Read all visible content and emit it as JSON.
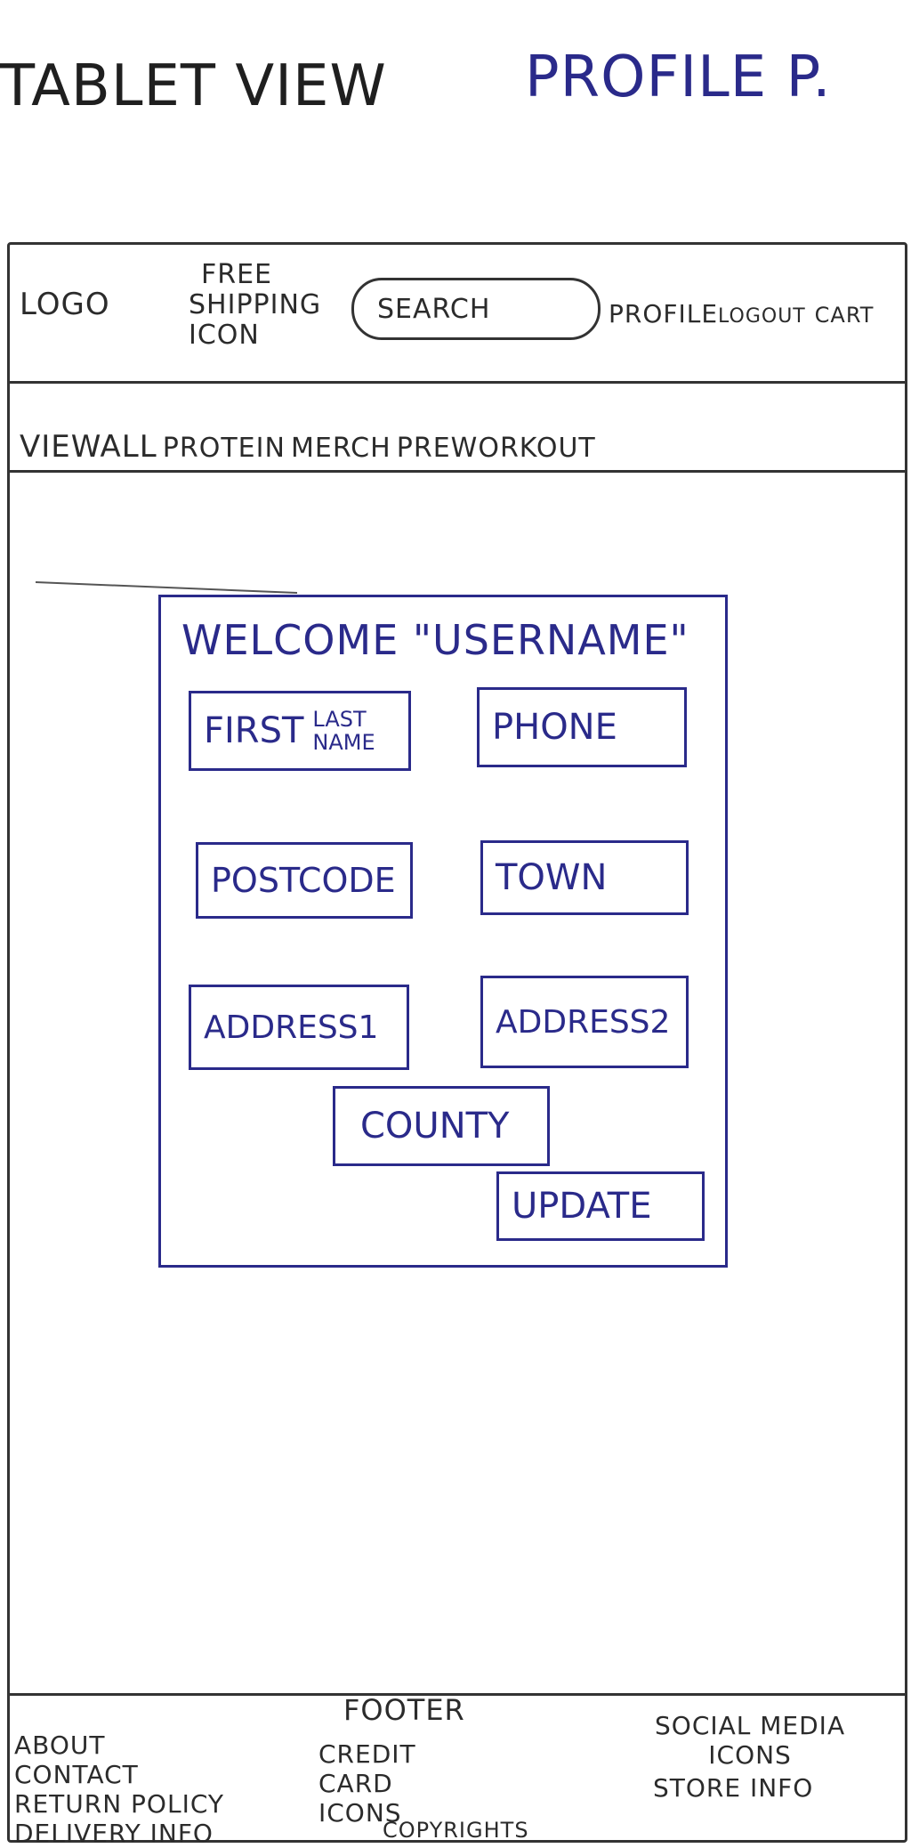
{
  "page": {
    "title_part1": "TABLET VIEW",
    "title_part2": "PROFILE P."
  },
  "header": {
    "logo": "LOGO",
    "shipping_line1": "FREE",
    "shipping_line2": "SHIPPING",
    "shipping_line3": "ICON",
    "search_label": "SEARCH",
    "profile": "PROFILE",
    "logout": "LOGOUT",
    "cart": "CART"
  },
  "nav": {
    "items": [
      {
        "label": "VIEWALL"
      },
      {
        "label": "PROTEIN"
      },
      {
        "label": "MERCH"
      },
      {
        "label": "PREWORKOUT"
      }
    ]
  },
  "profile_form": {
    "welcome": "WELCOME \"USERNAME\"",
    "first": "FIRST",
    "last_line1": "LAST",
    "last_line2": "NAME",
    "phone": "PHONE",
    "postcode": "POSTCODE",
    "town": "TOWN",
    "address1": "ADDRESS1",
    "address2": "ADDRESS2",
    "county": "COUNTY",
    "update": "UPDATE"
  },
  "footer": {
    "title": "FOOTER",
    "about": "ABOUT",
    "contact": "CONTACT",
    "return_policy": "RETURN POLICY",
    "delivery_info": "DELIVERY INFO",
    "credit_line1": "CREDIT",
    "credit_line2": "CARD",
    "credit_line3": "ICONS",
    "copyrights": "COPYRIGHTS",
    "social_line1": "SOCIAL MEDIA",
    "social_line2": "ICONS",
    "store_info": "STORE INFO"
  },
  "colors": {
    "pencil": "#2b2b2b",
    "ink_blue": "#2a2a8a",
    "paper": "#ffffff"
  }
}
